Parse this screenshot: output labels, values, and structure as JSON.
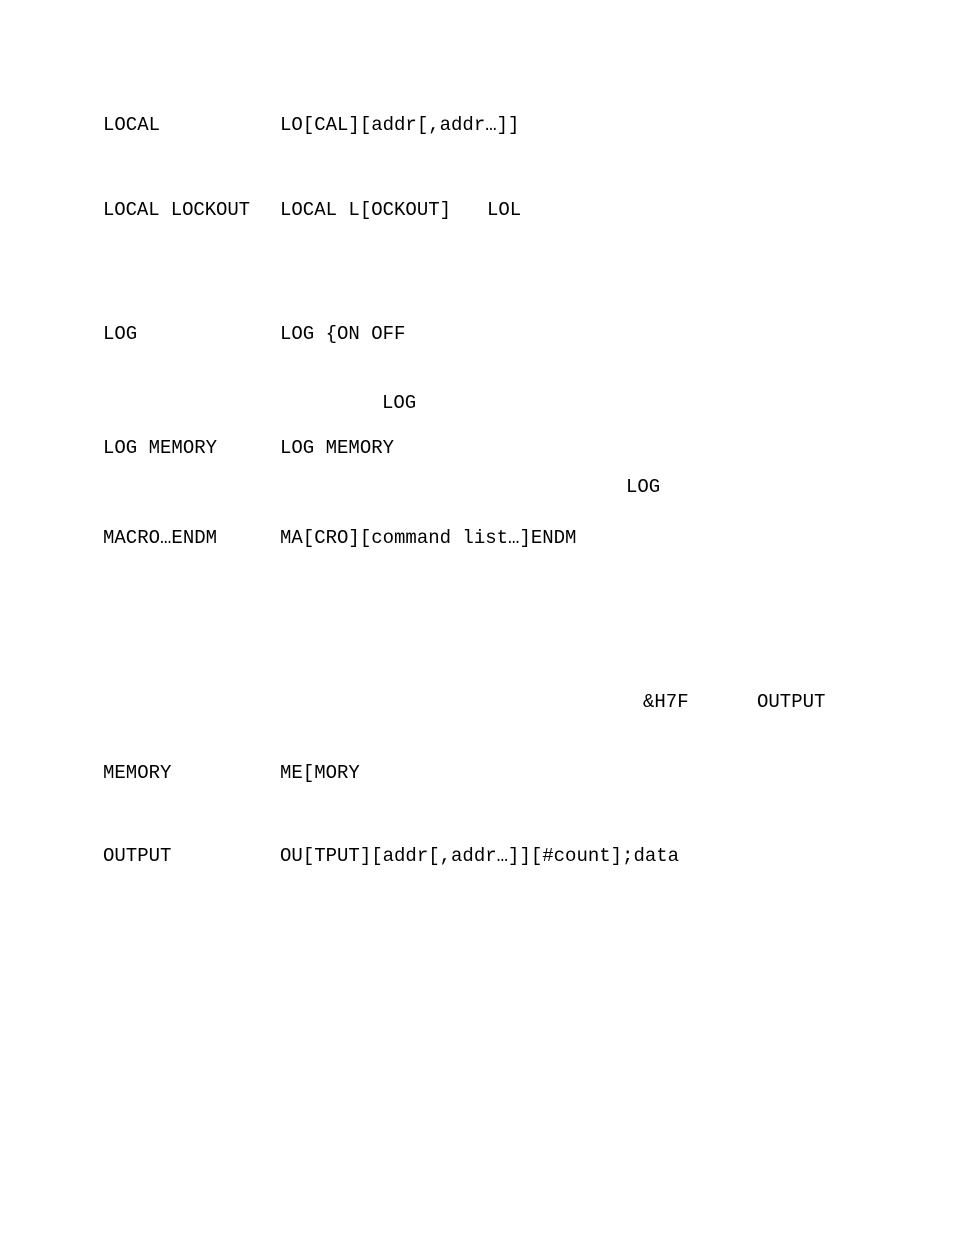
{
  "rows": [
    {
      "name": "LOCAL",
      "syntax": "LO[CAL][addr[,addr…]]"
    },
    {
      "name": "LOCAL LOCKOUT",
      "syntax": "LOCAL L[OCKOUT]",
      "alt": "LOL"
    },
    {
      "name": "LOG",
      "syntax": "LOG {ON OFF"
    },
    {
      "name": "LOG MEMORY",
      "syntax": "LOG MEMORY"
    },
    {
      "name": "MACRO…ENDM",
      "syntax": "MA[CRO][command list…]ENDM"
    },
    {
      "name": "MEMORY",
      "syntax": "ME[MORY"
    },
    {
      "name": "OUTPUT",
      "syntax": "OU[TPUT][addr[,addr…]][#count];data"
    }
  ],
  "inline": {
    "log_ref": "LOG",
    "log_ref2": "LOG",
    "hex": "&H7F",
    "output_ref": "OUTPUT"
  }
}
